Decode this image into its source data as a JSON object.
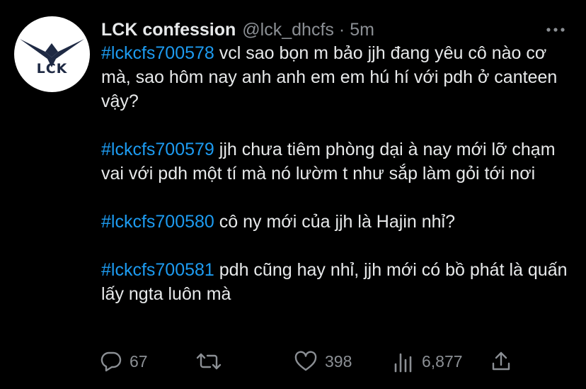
{
  "tweet": {
    "display_name": "LCK confession",
    "handle": "@lck_dhcfs",
    "separator": "·",
    "time": "5m",
    "avatar_text": "LCK",
    "paragraphs": [
      {
        "hashtag": "#lckcfs700578",
        "text": " vcl sao bọn m bảo jjh đang yêu cô nào cơ mà, sao hôm nay anh anh em em hú hí với pdh ở canteen vậy?"
      },
      {
        "hashtag": "#lckcfs700579",
        "text": " jjh chưa tiêm phòng dại à nay mới lỡ chạm vai với pdh một tí mà nó lườm t như sắp làm gỏi tới nơi"
      },
      {
        "hashtag": "#lckcfs700580",
        "text": " cô ny mới của jjh là Hajin nhỉ?"
      },
      {
        "hashtag": "#lckcfs700581",
        "text": " pdh cũng hay nhỉ, jjh mới có bồ phát là quấn lấy ngta luôn mà"
      }
    ]
  },
  "actions": {
    "reply_count": "67",
    "retweet_count": "",
    "like_count": "398",
    "views_count": "6,877"
  },
  "icons": {
    "more": "more-dots-icon",
    "reply": "reply-bubble-icon",
    "retweet": "retweet-icon",
    "like": "heart-icon",
    "views": "views-bars-icon",
    "share": "share-upload-icon"
  },
  "colors": {
    "background": "#000000",
    "text": "#e7e9ea",
    "secondary": "#8b8f94",
    "hashtag": "#1d9bf0",
    "avatar_bg": "#ffffff",
    "logo": "#1f2a44"
  }
}
